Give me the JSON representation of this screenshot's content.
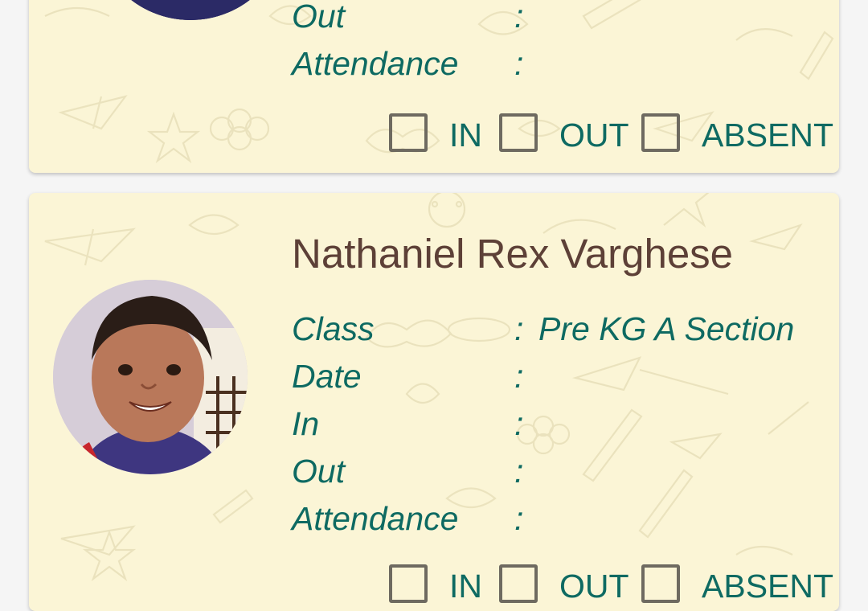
{
  "colors": {
    "card_background": "#fbf5d6",
    "name_text": "#5d4037",
    "label_text": "#0e6a62",
    "checkbox_border": "#6e6a60",
    "page_background": "#f5f5f5"
  },
  "separator": ":",
  "students": [
    {
      "name": "",
      "fields": [
        {
          "label": "Out",
          "value": ""
        },
        {
          "label": "Attendance",
          "value": ""
        }
      ],
      "options": [
        {
          "label": "IN",
          "checked": false
        },
        {
          "label": "OUT",
          "checked": false
        },
        {
          "label": "ABSENT",
          "checked": false
        }
      ]
    },
    {
      "name": "Nathaniel Rex Varghese",
      "fields": [
        {
          "label": "Class",
          "value": "Pre KG A Section"
        },
        {
          "label": "Date",
          "value": ""
        },
        {
          "label": "In",
          "value": ""
        },
        {
          "label": "Out",
          "value": ""
        },
        {
          "label": "Attendance",
          "value": ""
        }
      ],
      "options": [
        {
          "label": "IN",
          "checked": false
        },
        {
          "label": "OUT",
          "checked": false
        },
        {
          "label": "ABSENT",
          "checked": false
        }
      ]
    }
  ]
}
